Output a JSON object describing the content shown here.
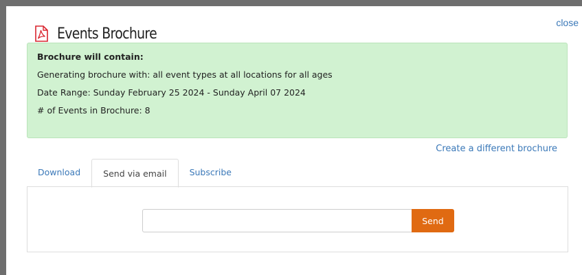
{
  "modal": {
    "close_label": "close",
    "title": "Events Brochure"
  },
  "info": {
    "heading": "Brochure will contain:",
    "generating": "Generating brochure with: all event types at all locations for all ages",
    "date_range": "Date Range: Sunday February 25 2024 - Sunday April 07 2024",
    "event_count": "# of Events in Brochure: 8"
  },
  "different_link": "Create a different brochure",
  "tabs": [
    {
      "label": "Download",
      "active": false
    },
    {
      "label": "Send via email",
      "active": true
    },
    {
      "label": "Subscribe",
      "active": false
    }
  ],
  "email": {
    "value": "",
    "placeholder": "",
    "send_label": "Send"
  },
  "colors": {
    "accent": "#e06a12",
    "link": "#3a78b8",
    "info_bg": "#d1f2d1",
    "pdf_icon": "#d9232d"
  }
}
